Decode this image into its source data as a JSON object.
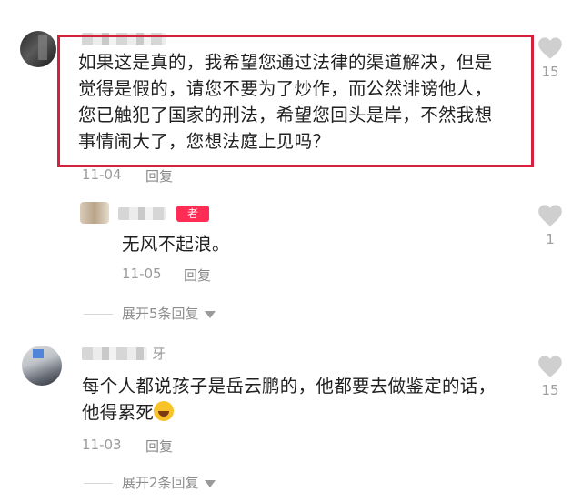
{
  "comments": [
    {
      "text_lines": [
        "如果这是真的，我希望您通过法律的渠道解决，但是",
        "觉得是假的，请您不要为了炒作，而公然诽谤他人，",
        "您已触犯了国家的刑法，希望您回头是岸，不然我想",
        "事情闹大了，您想法庭上见吗？"
      ],
      "date": "11-04",
      "reply_label": "回复",
      "likes": "15"
    },
    {
      "author_badge": "者",
      "text": "无风不起浪。",
      "date": "11-05",
      "reply_label": "回复",
      "likes": "1",
      "expand_label": "展开5条回复"
    },
    {
      "name_fragment": "牙",
      "text_lines": [
        "每个人都说孩子是岳云鹏的，他都要去做鉴定的话，",
        "他得累死"
      ],
      "emoji": "grinning-squinting-face",
      "date": "11-03",
      "reply_label": "回复",
      "likes": "15",
      "expand_label": "展开2条回复"
    }
  ],
  "colors": {
    "highlight_border": "#d4213d",
    "author_badge": "#ff2d55",
    "meta_text": "#9b9b9b"
  }
}
